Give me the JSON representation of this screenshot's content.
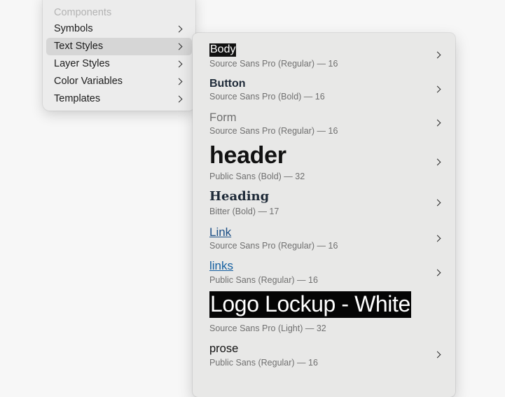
{
  "menu": {
    "header": "Components",
    "items": [
      {
        "label": "Symbols",
        "selected": false
      },
      {
        "label": "Text Styles",
        "selected": true
      },
      {
        "label": "Layer Styles",
        "selected": false
      },
      {
        "label": "Color Variables",
        "selected": false
      },
      {
        "label": "Templates",
        "selected": false
      }
    ]
  },
  "submenu": {
    "items": [
      {
        "name": "Body",
        "meta": "Source Sans Pro (Regular) — 16",
        "has_submenu": true
      },
      {
        "name": "Button",
        "meta": "Source Sans Pro (Bold) — 16",
        "has_submenu": true
      },
      {
        "name": "Form",
        "meta": "Source Sans Pro (Regular) — 16",
        "has_submenu": true
      },
      {
        "name": "header",
        "meta": "Public Sans (Bold) — 32",
        "has_submenu": true
      },
      {
        "name": "Heading",
        "meta": "Bitter (Bold) — 17",
        "has_submenu": true
      },
      {
        "name": "Link",
        "meta": "Source Sans Pro (Regular) — 16",
        "has_submenu": true
      },
      {
        "name": "links",
        "meta": "Public Sans (Regular) — 16",
        "has_submenu": true
      },
      {
        "name": "Logo Lockup - White",
        "meta": "Source Sans Pro (Light) — 32",
        "has_submenu": false
      },
      {
        "name": "prose",
        "meta": "Public Sans (Regular) — 16",
        "has_submenu": true
      }
    ]
  },
  "colors": {
    "menu_bg": "#ececec",
    "selected_bg": "#d6d6d6",
    "submenu_bg": "#e8e8e7",
    "link": "#1c4f86",
    "links": "#145fa0",
    "heading": "#1e2a38"
  },
  "icons": {
    "submenu_indicator": "chevron-right-icon"
  }
}
